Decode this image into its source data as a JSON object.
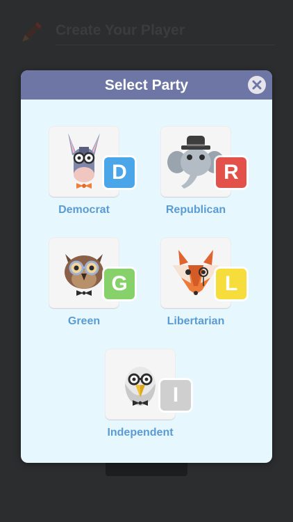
{
  "background": {
    "title": "Create Your Player",
    "pencil_icon": "pencil-icon"
  },
  "modal": {
    "title": "Select Party",
    "close_icon": "close-icon"
  },
  "parties": [
    {
      "label": "Democrat",
      "letter": "D",
      "animal": "donkey-icon",
      "badge_color": "#4aa6e8"
    },
    {
      "label": "Republican",
      "letter": "R",
      "animal": "elephant-icon",
      "badge_color": "#e2514a"
    },
    {
      "label": "Green",
      "letter": "G",
      "animal": "owl-icon",
      "badge_color": "#86d169"
    },
    {
      "label": "Libertarian",
      "letter": "L",
      "animal": "fox-icon",
      "badge_color": "#f7dd3c"
    },
    {
      "label": "Independent",
      "letter": "I",
      "animal": "eagle-icon",
      "badge_color": "#cfcfcf"
    }
  ],
  "colors": {
    "header": "#6d76a5",
    "modal_bg": "#e6f7fd",
    "label": "#5b9bd3"
  }
}
